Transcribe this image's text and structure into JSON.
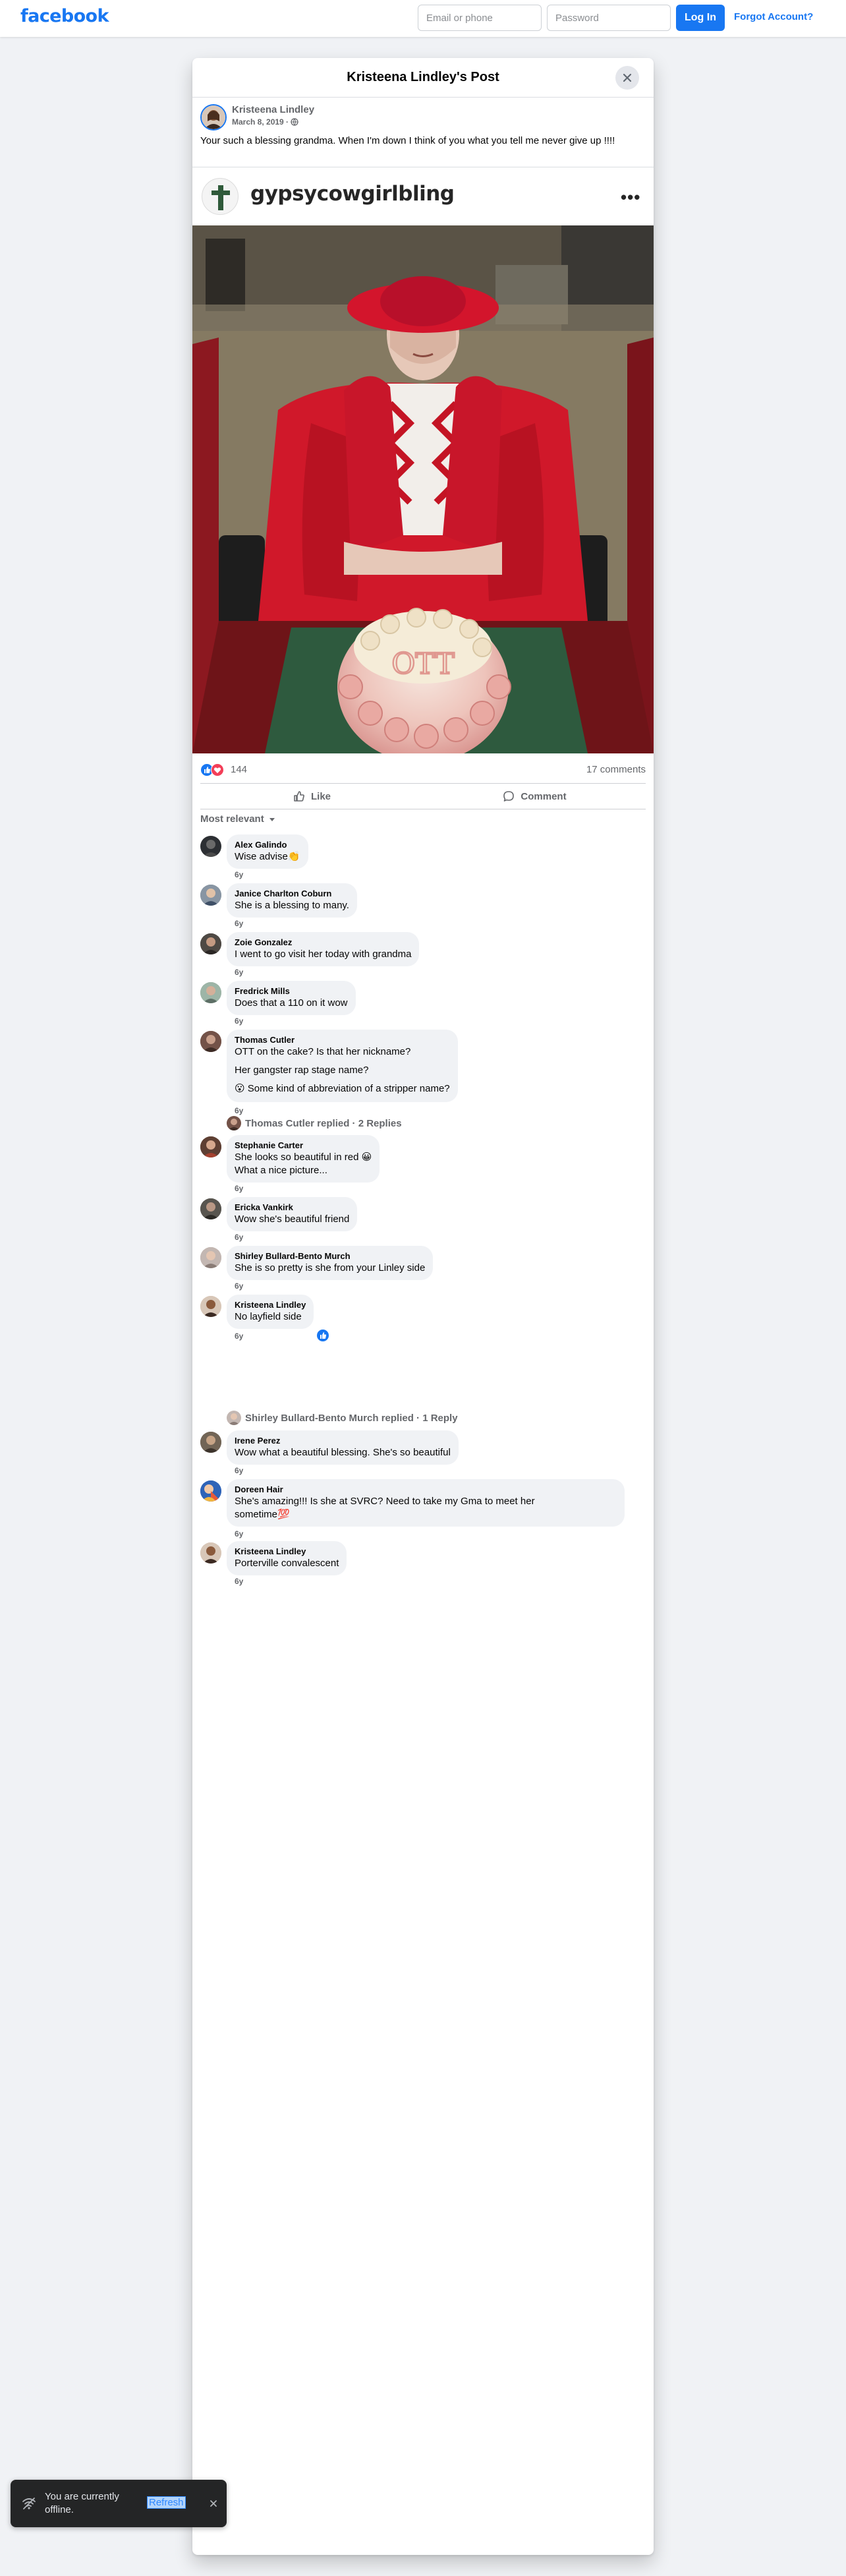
{
  "topnav": {
    "logo": "facebook",
    "email_placeholder": "Email or phone",
    "password_placeholder": "Password",
    "login_label": "Log In",
    "forgot_label": "Forgot Account?"
  },
  "modal": {
    "title": "Kristeena Lindley's Post",
    "author": "Kristeena Lindley",
    "date": "March 8, 2019 · ",
    "text": "Your such a blessing grandma.   When I'm down I think of you what you tell me never give up !!!!",
    "embed_handle": "gypsycowgirlbling",
    "embed_more": "•••",
    "photo_cake_text": "OTT",
    "reaction_count": "144",
    "comment_count": "17 comments",
    "like_label": "Like",
    "comment_label": "Comment",
    "sort_label": "Most relevant"
  },
  "comments": [
    {
      "name": "Alex Galindo",
      "lines": [
        "Wise advise👏"
      ],
      "age": "6y"
    },
    {
      "name": "Janice Charlton Coburn",
      "lines": [
        "She is a blessing to many."
      ],
      "age": "6y"
    },
    {
      "name": "Zoie Gonzalez",
      "lines": [
        "I went to go visit her today with grandma"
      ],
      "age": "6y"
    },
    {
      "name": "Fredrick Mills",
      "lines": [
        "Does that a 110 on it wow"
      ],
      "age": "6y"
    },
    {
      "name": "Thomas Cutler",
      "lines": [
        "OTT on the cake? Is that her nickname?",
        "Her gangster rap stage name?",
        "😮 Some kind of abbreviation of a stripper name?"
      ],
      "age": "6y"
    },
    {
      "name": "Stephanie Carter",
      "lines": [
        "She looks so beautiful in red 😀",
        "What a nice picture..."
      ],
      "age": "6y"
    },
    {
      "name": "Ericka Vankirk",
      "lines": [
        "Wow she's beautiful friend"
      ],
      "age": "6y"
    },
    {
      "name": "Shirley Bullard-Bento Murch",
      "lines": [
        "She is so pretty is she from your Linley side"
      ],
      "age": "6y"
    },
    {
      "name": "Kristeena Lindley",
      "lines": [
        "No layfield side"
      ],
      "age": "6y"
    },
    {
      "name": "Irene Perez",
      "lines": [
        "Wow what a beautiful blessing. She's so beautiful"
      ],
      "age": "6y"
    },
    {
      "name": "Doreen Hair",
      "lines": [
        "She's amazing!!! Is she at SVRC? Need to take my Gma to meet her",
        "sometime💯"
      ],
      "age": "6y"
    },
    {
      "name": "Kristeena Lindley",
      "lines": [
        "Porterville convalescent"
      ],
      "age": "6y"
    }
  ],
  "reply_threads": [
    {
      "label": "Thomas Cutler replied · 2 Replies"
    },
    {
      "label": "Shirley Bullard-Bento Murch replied · 1 Reply"
    }
  ],
  "toast": {
    "text": "You are currently offline.",
    "link": "Refresh"
  },
  "colors": {
    "brand": "#1877f2",
    "page_bg": "#f0f2f5",
    "muted": "#65676b"
  }
}
